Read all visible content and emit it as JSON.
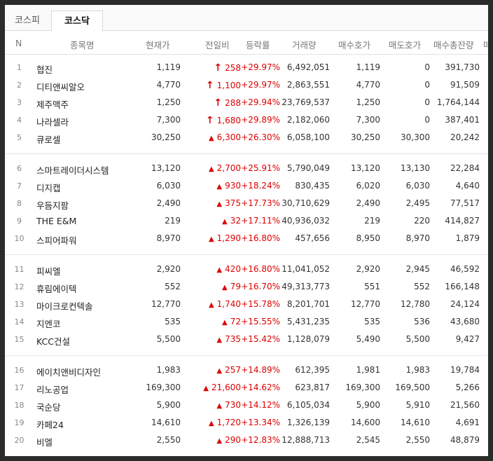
{
  "tabs": [
    {
      "label": "코스피",
      "active": false
    },
    {
      "label": "코스닥",
      "active": true
    }
  ],
  "columns": {
    "n": "N",
    "name": "종목명",
    "price": "현재가",
    "diff": "전일비",
    "rate": "등락률",
    "volume": "거래량",
    "bid": "매수호가",
    "ask": "매도호가",
    "remain": "매수총잔량",
    "more": "매"
  },
  "colors": {
    "up": "#d00000",
    "text": "#333333"
  },
  "groups": [
    [
      {
        "n": "1",
        "name": "협진",
        "price": "1,119",
        "arrow": "upper-limit",
        "diff": "258",
        "rate": "+29.97%",
        "volume": "6,492,051",
        "bid": "1,119",
        "ask": "0",
        "remain": "391,730"
      },
      {
        "n": "2",
        "name": "디티앤씨알오",
        "price": "4,770",
        "arrow": "upper-limit",
        "diff": "1,100",
        "rate": "+29.97%",
        "volume": "2,863,551",
        "bid": "4,770",
        "ask": "0",
        "remain": "91,509"
      },
      {
        "n": "3",
        "name": "제주맥주",
        "price": "1,250",
        "arrow": "upper-limit",
        "diff": "288",
        "rate": "+29.94%",
        "volume": "23,769,537",
        "bid": "1,250",
        "ask": "0",
        "remain": "1,764,144"
      },
      {
        "n": "4",
        "name": "나라셀라",
        "price": "7,300",
        "arrow": "upper-limit",
        "diff": "1,680",
        "rate": "+29.89%",
        "volume": "2,182,060",
        "bid": "7,300",
        "ask": "0",
        "remain": "387,401"
      },
      {
        "n": "5",
        "name": "큐로셀",
        "price": "30,250",
        "arrow": "up",
        "diff": "6,300",
        "rate": "+26.30%",
        "volume": "6,058,100",
        "bid": "30,250",
        "ask": "30,300",
        "remain": "20,242"
      }
    ],
    [
      {
        "n": "6",
        "name": "스마트레이더시스템",
        "price": "13,120",
        "arrow": "up",
        "diff": "2,700",
        "rate": "+25.91%",
        "volume": "5,790,049",
        "bid": "13,120",
        "ask": "13,130",
        "remain": "22,284"
      },
      {
        "n": "7",
        "name": "디지캡",
        "price": "6,030",
        "arrow": "up",
        "diff": "930",
        "rate": "+18.24%",
        "volume": "830,435",
        "bid": "6,020",
        "ask": "6,030",
        "remain": "4,640"
      },
      {
        "n": "8",
        "name": "우듬지팜",
        "price": "2,490",
        "arrow": "up",
        "diff": "375",
        "rate": "+17.73%",
        "volume": "30,710,629",
        "bid": "2,490",
        "ask": "2,495",
        "remain": "77,517"
      },
      {
        "n": "9",
        "name": "THE E&M",
        "price": "219",
        "arrow": "up",
        "diff": "32",
        "rate": "+17.11%",
        "volume": "40,936,032",
        "bid": "219",
        "ask": "220",
        "remain": "414,827"
      },
      {
        "n": "10",
        "name": "스피어파워",
        "price": "8,970",
        "arrow": "up",
        "diff": "1,290",
        "rate": "+16.80%",
        "volume": "457,656",
        "bid": "8,950",
        "ask": "8,970",
        "remain": "1,879"
      }
    ],
    [
      {
        "n": "11",
        "name": "피씨엘",
        "price": "2,920",
        "arrow": "up",
        "diff": "420",
        "rate": "+16.80%",
        "volume": "11,041,052",
        "bid": "2,920",
        "ask": "2,945",
        "remain": "46,592"
      },
      {
        "n": "12",
        "name": "휴림에이텍",
        "price": "552",
        "arrow": "up",
        "diff": "79",
        "rate": "+16.70%",
        "volume": "49,313,773",
        "bid": "551",
        "ask": "552",
        "remain": "166,148"
      },
      {
        "n": "13",
        "name": "마이크로컨텍솔",
        "price": "12,770",
        "arrow": "up",
        "diff": "1,740",
        "rate": "+15.78%",
        "volume": "8,201,701",
        "bid": "12,770",
        "ask": "12,780",
        "remain": "24,124"
      },
      {
        "n": "14",
        "name": "지엔코",
        "price": "535",
        "arrow": "up",
        "diff": "72",
        "rate": "+15.55%",
        "volume": "5,431,235",
        "bid": "535",
        "ask": "536",
        "remain": "43,680"
      },
      {
        "n": "15",
        "name": "KCC건설",
        "price": "5,500",
        "arrow": "up",
        "diff": "735",
        "rate": "+15.42%",
        "volume": "1,128,079",
        "bid": "5,490",
        "ask": "5,500",
        "remain": "9,427"
      }
    ],
    [
      {
        "n": "16",
        "name": "에이치앤비디자인",
        "price": "1,983",
        "arrow": "up",
        "diff": "257",
        "rate": "+14.89%",
        "volume": "612,395",
        "bid": "1,981",
        "ask": "1,983",
        "remain": "19,784"
      },
      {
        "n": "17",
        "name": "리노공업",
        "price": "169,300",
        "arrow": "up",
        "diff": "21,600",
        "rate": "+14.62%",
        "volume": "623,817",
        "bid": "169,300",
        "ask": "169,500",
        "remain": "5,266"
      },
      {
        "n": "18",
        "name": "국순당",
        "price": "5,900",
        "arrow": "up",
        "diff": "730",
        "rate": "+14.12%",
        "volume": "6,105,034",
        "bid": "5,900",
        "ask": "5,910",
        "remain": "21,560"
      },
      {
        "n": "19",
        "name": "카페24",
        "price": "14,610",
        "arrow": "up",
        "diff": "1,720",
        "rate": "+13.34%",
        "volume": "1,326,139",
        "bid": "14,600",
        "ask": "14,610",
        "remain": "4,691"
      },
      {
        "n": "20",
        "name": "비엘",
        "price": "2,550",
        "arrow": "up",
        "diff": "290",
        "rate": "+12.83%",
        "volume": "12,888,713",
        "bid": "2,545",
        "ask": "2,550",
        "remain": "48,879"
      }
    ]
  ]
}
